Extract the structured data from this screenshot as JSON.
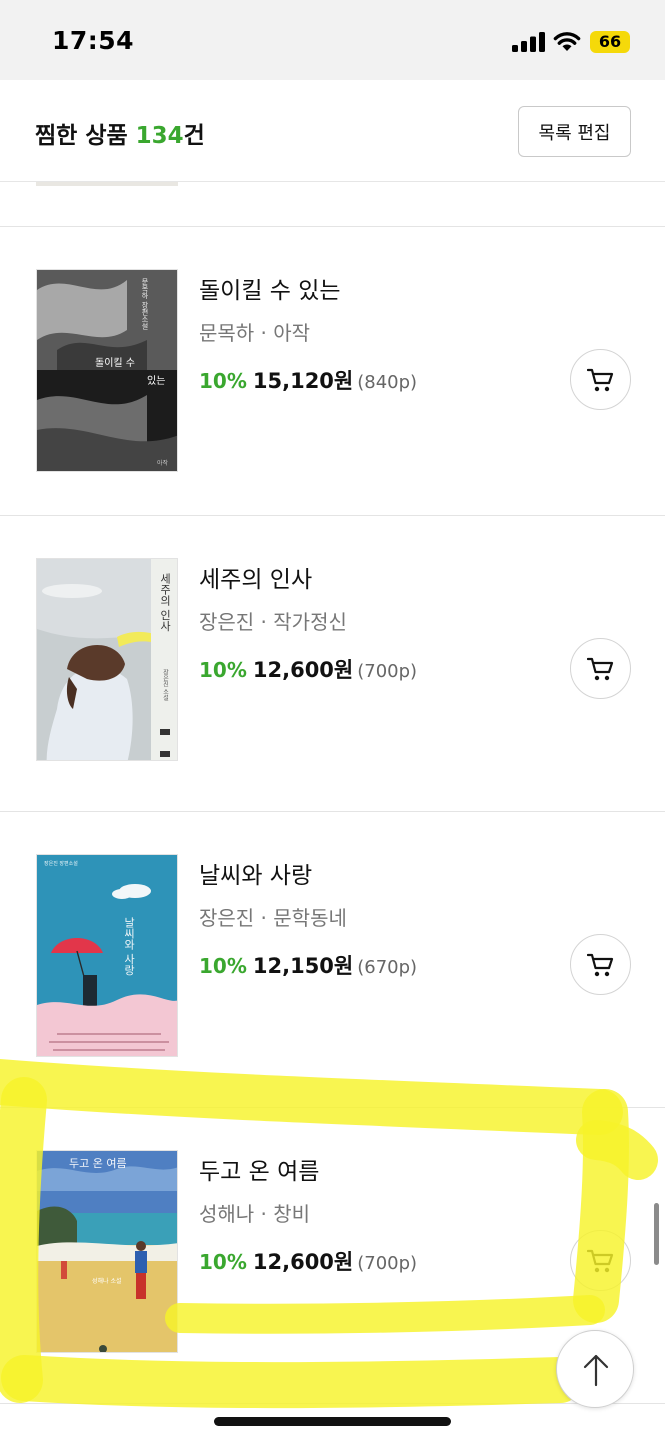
{
  "status_bar": {
    "time": "17:54",
    "battery": "66"
  },
  "header": {
    "title_prefix": "찜한 상품 ",
    "count": "134",
    "title_suffix": "건",
    "edit_label": "목록 편집"
  },
  "items": [
    {
      "title": "돌이킬 수 있는",
      "meta": "문목하 · 아작",
      "discount": "10%",
      "price": "15,120원",
      "points": "(840p)",
      "cover": {
        "series": "문목하 장편소설",
        "title_a": "돌이킬 수",
        "title_b": "있는",
        "publisher": "아작"
      }
    },
    {
      "title": "세주의 인사",
      "meta": "장은진 · 작가정신",
      "discount": "10%",
      "price": "12,600원",
      "points": "(700p)",
      "cover": {
        "title": "세주의 인사",
        "author": "장은진 소설"
      }
    },
    {
      "title": "날씨와 사랑",
      "meta": "장은진 · 문학동네",
      "discount": "10%",
      "price": "12,150원",
      "points": "(670p)",
      "cover": {
        "series": "장은진 장편소설",
        "title": "날씨와 사랑"
      }
    },
    {
      "title": "두고 온 여름",
      "meta": "성해나 · 창비",
      "discount": "10%",
      "price": "12,600원",
      "points": "(700p)",
      "cover": {
        "title": "두고 온 여름",
        "author": "성해나 소설"
      }
    }
  ],
  "colors": {
    "accent_green": "#3aa72f",
    "highlight_yellow": "#f7f32a",
    "battery_yellow": "#f5d90a"
  },
  "icons": {
    "cart": "cart-icon",
    "scroll_top": "arrow-up-icon",
    "signal": "signal-icon",
    "wifi": "wifi-icon"
  }
}
